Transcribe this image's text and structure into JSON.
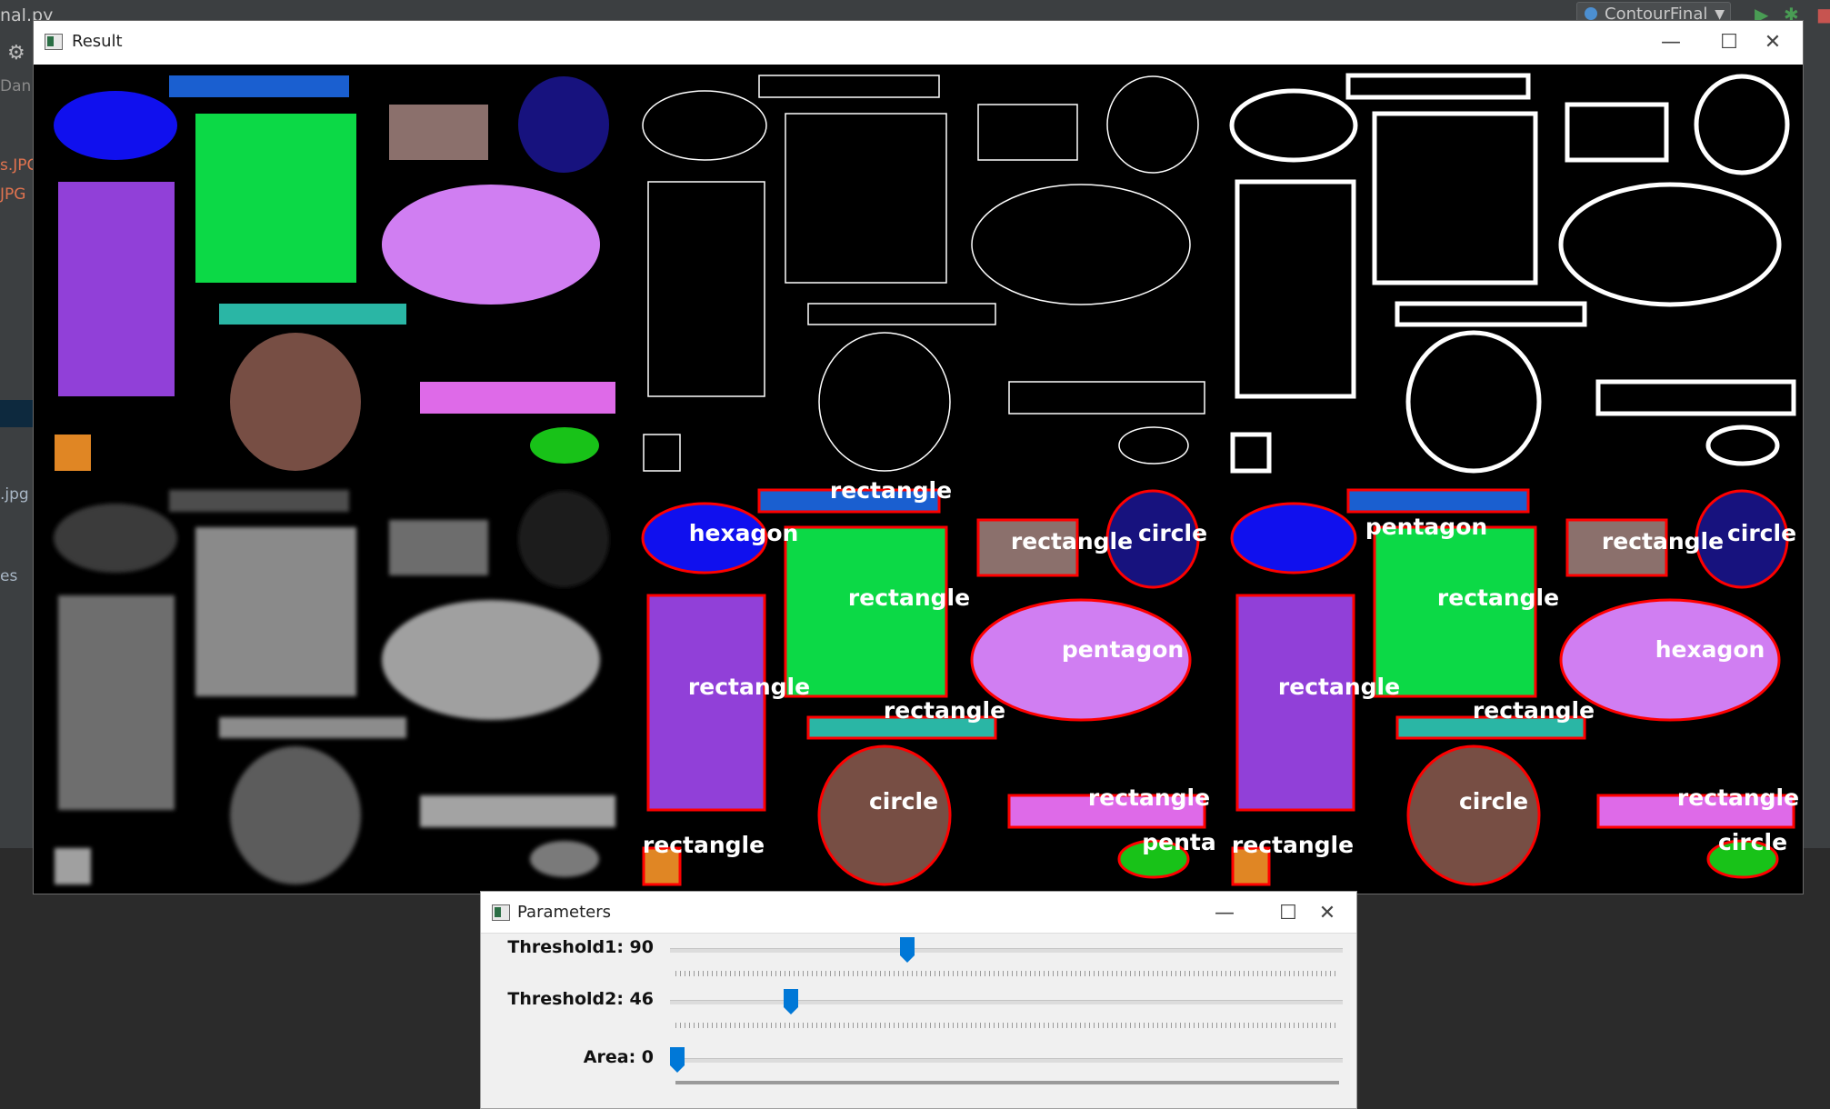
{
  "ide": {
    "file_tab": "nal.py",
    "run_config": "ContourFinal",
    "sidebar_texts": [
      {
        "text": "Dan",
        "color": "#8a8a8a"
      },
      {
        "text": "s.JPG",
        "color": "#e0734f"
      },
      {
        "text": "JPG",
        "color": "#e0734f"
      },
      {
        "text": ".jpg",
        "color": "#a9b7c6"
      },
      {
        "text": "es",
        "color": "#a9b7c6"
      }
    ]
  },
  "result_window": {
    "title": "Result",
    "controls": {
      "minimize": "—",
      "maximize": "☐",
      "close": "✕"
    },
    "labels": {
      "panel5": [
        "hexagon",
        "rectangle",
        "circle",
        "rectangle",
        "rectangle",
        "pentagon",
        "rectangle",
        "rectangle",
        "circle",
        "rectangle",
        "rectangle",
        "penta"
      ],
      "panel6": [
        "pentagon",
        "rectangle",
        "circle",
        "rectangle",
        "hexagon",
        "rectangle",
        "rectangle",
        "circle",
        "rectangle",
        "rectangle",
        "circle"
      ]
    }
  },
  "params_window": {
    "title": "Parameters",
    "controls": {
      "minimize": "—",
      "maximize": "☐",
      "close": "✕"
    },
    "sliders": [
      {
        "label": "Threshold1: 90",
        "value": 90,
        "max": 255
      },
      {
        "label": "Threshold2: 46",
        "value": 46,
        "max": 255
      },
      {
        "label": "Area: 0",
        "value": 0,
        "max": 30000
      }
    ]
  },
  "colors": {
    "accent_thumb": "#0078d7",
    "contour": "#ff0000",
    "blue_bar": "#1a5fd0",
    "blue_ellipse": "#1010ee",
    "green_square": "#0cd946",
    "taupe_rect": "#8b706c",
    "navy_circle": "#17127e",
    "purple_rect": "#9140d8",
    "lilac_ellipse": "#d07ef2",
    "teal_bar": "#2ab6a5",
    "brown_circle": "#774e44",
    "magenta_bar": "#de6ae8",
    "orange_square": "#e08624",
    "green_ellipse": "#18c218"
  }
}
